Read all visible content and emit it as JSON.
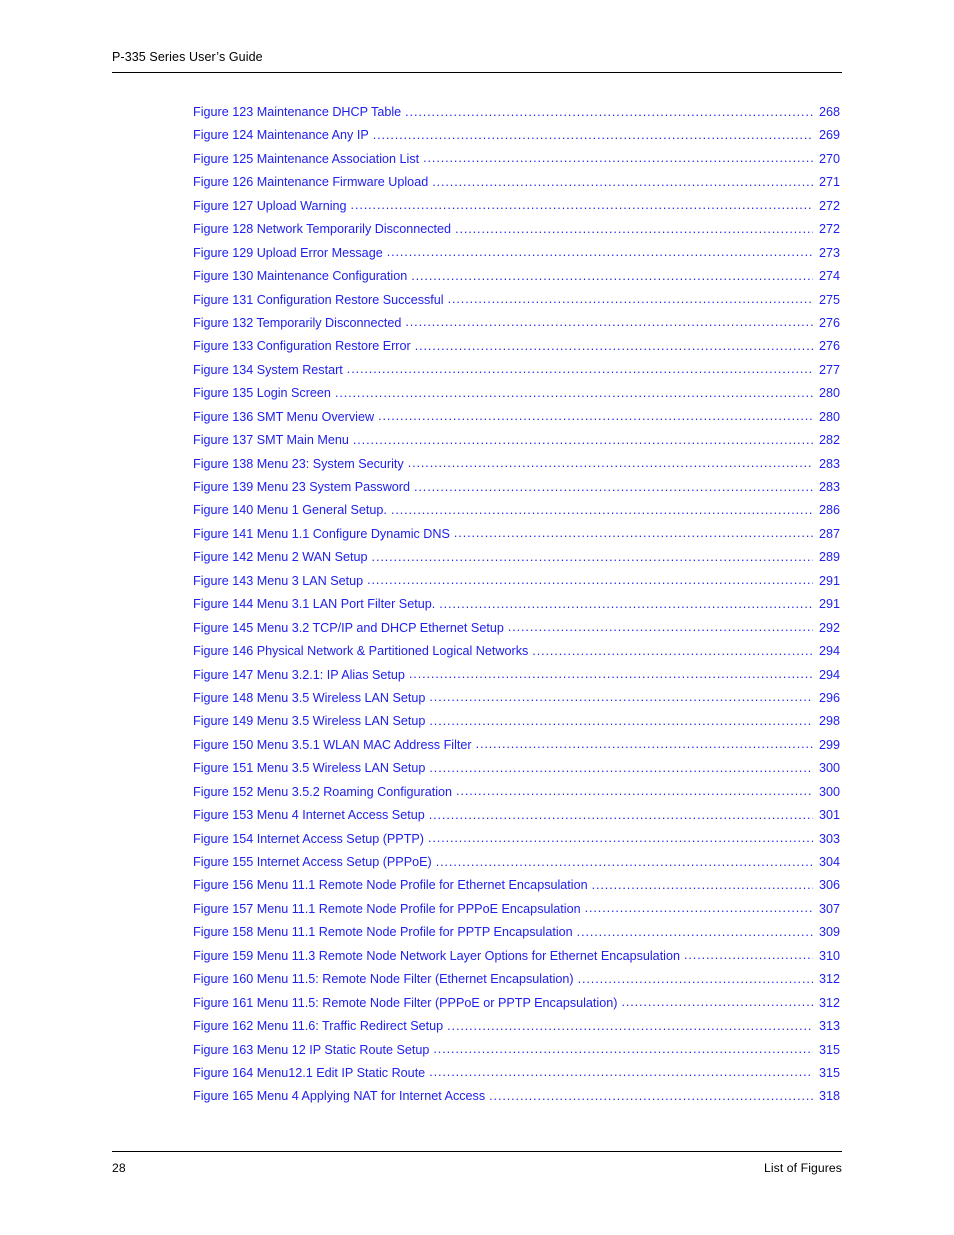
{
  "header": {
    "title": "P-335 Series User’s Guide"
  },
  "footer": {
    "page_number": "28",
    "section": "List of Figures"
  },
  "colors": {
    "entry_text": "#2020ee",
    "header_text": "#000000",
    "rule": "#000000",
    "background": "#ffffff"
  },
  "list_of_figures": {
    "entries": [
      {
        "label": "Figure 123 Maintenance DHCP Table",
        "page": "268"
      },
      {
        "label": "Figure 124 Maintenance Any IP",
        "page": "269"
      },
      {
        "label": "Figure 125 Maintenance Association List ",
        "page": "270"
      },
      {
        "label": "Figure 126 Maintenance Firmware Upload",
        "page": "271"
      },
      {
        "label": "Figure 127 Upload Warning ",
        "page": "272"
      },
      {
        "label": "Figure 128 Network Temporarily Disconnected ",
        "page": "272"
      },
      {
        "label": "Figure 129 Upload Error Message",
        "page": "273"
      },
      {
        "label": "Figure 130 Maintenance Configuration",
        "page": "274"
      },
      {
        "label": "Figure 131 Configuration Restore Successful",
        "page": "275"
      },
      {
        "label": "Figure 132 Temporarily Disconnected",
        "page": "276"
      },
      {
        "label": "Figure 133 Configuration Restore Error",
        "page": "276"
      },
      {
        "label": "Figure 134 System Restart ",
        "page": "277"
      },
      {
        "label": "Figure 135 Login Screen",
        "page": "280"
      },
      {
        "label": "Figure 136 SMT Menu Overview ",
        "page": "280"
      },
      {
        "label": "Figure 137 SMT Main Menu",
        "page": "282"
      },
      {
        "label": "Figure 138 Menu 23: System Security",
        "page": "283"
      },
      {
        "label": "Figure 139 Menu 23 System Password",
        "page": "283"
      },
      {
        "label": "Figure 140 Menu 1 General Setup.",
        "page": "286"
      },
      {
        "label": "Figure 141 Menu 1.1 Configure Dynamic DNS ",
        "page": "287"
      },
      {
        "label": "Figure 142 Menu 2 WAN Setup ",
        "page": "289"
      },
      {
        "label": "Figure 143 Menu 3 LAN Setup",
        "page": "291"
      },
      {
        "label": "Figure 144 Menu 3.1 LAN Port Filter Setup.",
        "page": "291"
      },
      {
        "label": "Figure 145 Menu 3.2 TCP/IP and DHCP Ethernet Setup",
        "page": "292"
      },
      {
        "label": "Figure 146 Physical Network & Partitioned Logical Networks",
        "page": "294"
      },
      {
        "label": "Figure 147 Menu 3.2.1: IP Alias Setup",
        "page": "294"
      },
      {
        "label": "Figure 148 Menu 3.5 Wireless LAN Setup",
        "page": "296"
      },
      {
        "label": "Figure 149 Menu 3.5 Wireless LAN Setup ",
        "page": "298"
      },
      {
        "label": "Figure 150 Menu 3.5.1 WLAN MAC Address Filter ",
        "page": "299"
      },
      {
        "label": "Figure 151 Menu 3.5 Wireless LAN Setup",
        "page": "300"
      },
      {
        "label": "Figure 152 Menu 3.5.2 Roaming Configuration",
        "page": "300"
      },
      {
        "label": "Figure 153 Menu 4 Internet Access Setup",
        "page": "301"
      },
      {
        "label": "Figure 154 Internet Access Setup (PPTP) ",
        "page": "303"
      },
      {
        "label": "Figure 155 Internet Access Setup (PPPoE)",
        "page": "304"
      },
      {
        "label": "Figure 156 Menu 11.1 Remote Node Profile for Ethernet Encapsulation",
        "page": "306"
      },
      {
        "label": "Figure 157 Menu 11.1 Remote Node Profile for PPPoE Encapsulation",
        "page": "307"
      },
      {
        "label": "Figure 158 Menu 11.1 Remote Node Profile for PPTP Encapsulation",
        "page": "309"
      },
      {
        "label": "Figure 159 Menu 11.3 Remote Node Network Layer Options for Ethernet Encapsulation ",
        "page": "310"
      },
      {
        "label": "Figure 160 Menu 11.5: Remote Node Filter (Ethernet Encapsulation)",
        "page": "312"
      },
      {
        "label": "Figure 161 Menu 11.5: Remote Node Filter (PPPoE or PPTP Encapsulation) ",
        "page": "312"
      },
      {
        "label": "Figure 162  Menu 11.6: Traffic Redirect Setup",
        "page": "313"
      },
      {
        "label": "Figure 163 Menu 12 IP Static Route Setup ",
        "page": "315"
      },
      {
        "label": "Figure 164 Menu12.1 Edit IP Static Route",
        "page": "315"
      },
      {
        "label": "Figure 165 Menu 4 Applying NAT for Internet Access ",
        "page": "318"
      }
    ]
  }
}
